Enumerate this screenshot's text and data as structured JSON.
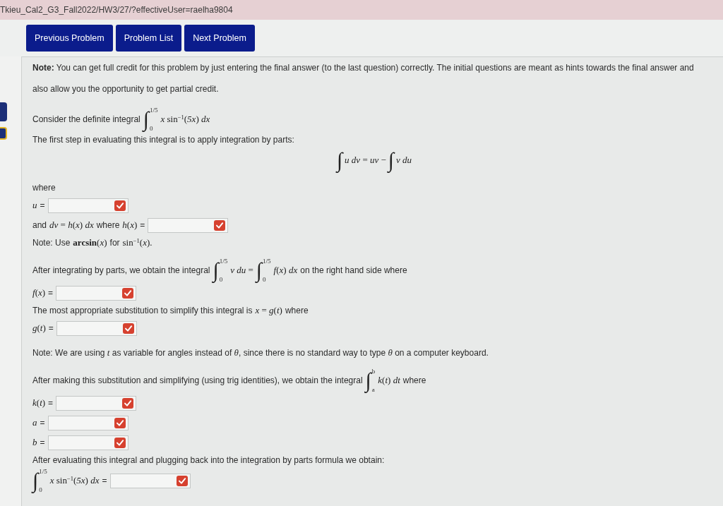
{
  "address_bar": {
    "url": "Tkieu_Cal2_G3_Fall2022/HW3/27/?effectiveUser=raelha9804"
  },
  "nav_buttons": [
    {
      "label": "Previous Problem"
    },
    {
      "label": "Problem List"
    },
    {
      "label": "Next Problem"
    }
  ],
  "problem": {
    "paragraphs": [
      {
        "lines": [
          {
            "kind": "paragraph",
            "parts": [
              {
                "kind": "text",
                "text": "**Note:** You can get full credit for this problem by just entering the final answer (to the last question) correctly. The initial questions are meant as hints towards the final answer and also allow you the opportunity to get partial credit."
              }
            ]
          }
        ]
      },
      {
        "lines": [
          {
            "kind": "plain",
            "parts": [
              {
                "kind": "text",
                "text": "Consider the definite integral"
              },
              {
                "kind": "integral",
                "sign": "∫",
                "upper": "1/5",
                "lower": "0"
              },
              {
                "kind": "math",
                "text": "*x* sin$^{−1}$(*5x*) *dx*"
              }
            ]
          },
          {
            "kind": "plain",
            "parts": [
              {
                "kind": "text",
                "text": "The first step in evaluating this integral is to apply integration by parts:"
              }
            ]
          },
          {
            "kind": "display",
            "parts": [
              {
                "kind": "integral",
                "sign": "∫"
              },
              {
                "kind": "math",
                "text": "*u dv* = *uv* −"
              },
              {
                "kind": "integral",
                "sign": "∫"
              },
              {
                "kind": "math",
                "text": "*v du*"
              }
            ]
          }
        ]
      },
      {
        "lines": [
          {
            "kind": "plain",
            "parts": [
              {
                "kind": "text",
                "text": "where"
              }
            ]
          },
          {
            "kind": "answer",
            "parts": [
              {
                "kind": "math",
                "text": "*u*"
              },
              {
                "kind": "text",
                "text": "="
              },
              {
                "kind": "field"
              }
            ]
          },
          {
            "kind": "answer",
            "parts": [
              {
                "kind": "text",
                "text": "and"
              },
              {
                "kind": "math",
                "text": "*dv* = *h*(*x*) *dx*"
              },
              {
                "kind": "text",
                "text": "where"
              },
              {
                "kind": "math",
                "text": "*h*(*x*)"
              },
              {
                "kind": "text",
                "text": "="
              },
              {
                "kind": "field"
              }
            ]
          },
          {
            "kind": "plain",
            "parts": [
              {
                "kind": "text",
                "text": "Note: Use"
              },
              {
                "kind": "math",
                "text": "**arcsin**(*x*)"
              },
              {
                "kind": "text",
                "text": "for"
              },
              {
                "kind": "math",
                "text": "sin$^{−1}$(*x*)."
              }
            ]
          }
        ]
      },
      {
        "lines": [
          {
            "kind": "plain",
            "parts": [
              {
                "kind": "text",
                "text": "After integrating by parts, we obtain the integral"
              },
              {
                "kind": "integral",
                "sign": "∫",
                "upper": "1/5",
                "lower": "0"
              },
              {
                "kind": "math",
                "text": "*v du* ="
              },
              {
                "kind": "integral",
                "sign": "∫",
                "upper": "1/5",
                "lower": "0"
              },
              {
                "kind": "math",
                "text": "*f*(*x*) *dx*"
              },
              {
                "kind": "text",
                "text": "on the right hand side where"
              }
            ]
          },
          {
            "kind": "answer",
            "parts": [
              {
                "kind": "math",
                "text": "*f*(*x*)"
              },
              {
                "kind": "text",
                "text": "="
              },
              {
                "kind": "field"
              }
            ]
          },
          {
            "kind": "plain",
            "parts": [
              {
                "kind": "text",
                "text": "The most appropriate substitution to simplify this integral is"
              },
              {
                "kind": "math",
                "text": "*x* = *g*(*t*)"
              },
              {
                "kind": "text",
                "text": "where"
              }
            ]
          },
          {
            "kind": "answer",
            "parts": [
              {
                "kind": "math",
                "text": "*g*(*t*)"
              },
              {
                "kind": "text",
                "text": "="
              },
              {
                "kind": "field"
              }
            ]
          }
        ]
      },
      {
        "lines": [
          {
            "kind": "plain",
            "parts": [
              {
                "kind": "text",
                "text": "Note: We are using *t* as variable for angles instead of *θ*, since there is no standard way to type *θ* on a computer keyboard."
              }
            ]
          }
        ]
      },
      {
        "lines": [
          {
            "kind": "plain",
            "parts": [
              {
                "kind": "text",
                "text": "After making this substitution and simplifying (using trig identities), we obtain the integral"
              },
              {
                "kind": "integral",
                "sign": "∫",
                "upper": "b",
                "lower": "a"
              },
              {
                "kind": "math",
                "text": "*k*(*t*) *dt*"
              },
              {
                "kind": "text",
                "text": "where"
              }
            ]
          },
          {
            "kind": "answer",
            "parts": [
              {
                "kind": "math",
                "text": "*k*(*t*)"
              },
              {
                "kind": "text",
                "text": "="
              },
              {
                "kind": "field"
              }
            ]
          },
          {
            "kind": "answer",
            "parts": [
              {
                "kind": "math",
                "text": "*a*"
              },
              {
                "kind": "text",
                "text": "="
              },
              {
                "kind": "field"
              }
            ]
          },
          {
            "kind": "answer",
            "parts": [
              {
                "kind": "math",
                "text": "*b*"
              },
              {
                "kind": "text",
                "text": "="
              },
              {
                "kind": "field"
              }
            ]
          },
          {
            "kind": "plain",
            "parts": [
              {
                "kind": "text",
                "text": "After evaluating this integral and plugging back into the integration by parts formula we obtain:"
              }
            ]
          },
          {
            "kind": "answer",
            "parts": [
              {
                "kind": "integral",
                "sign": "∫",
                "upper": "1/5",
                "lower": "0"
              },
              {
                "kind": "math",
                "text": "*x* sin$^{−1}$(*5x*) *dx*"
              },
              {
                "kind": "text",
                "text": "="
              },
              {
                "kind": "field"
              }
            ]
          }
        ]
      }
    ]
  }
}
